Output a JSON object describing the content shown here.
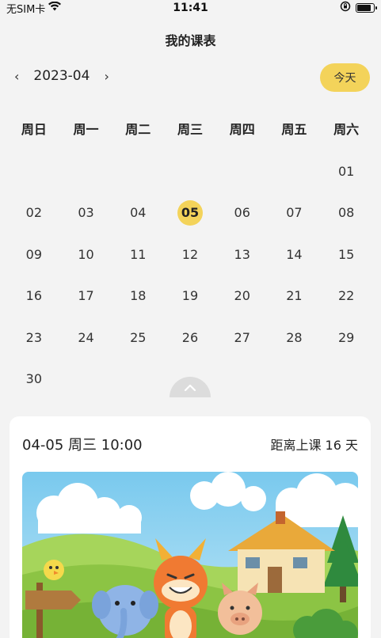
{
  "status": {
    "carrier": "无SIM卡",
    "time": "11:41",
    "battery_level": 0.75
  },
  "header": {
    "title": "我的课表"
  },
  "month_nav": {
    "prev_icon": "‹",
    "month": "2023-04",
    "next_icon": "›",
    "today_label": "今天"
  },
  "weekdays": [
    "周日",
    "周一",
    "周二",
    "周三",
    "周四",
    "周五",
    "周六"
  ],
  "calendar": {
    "leading_blanks": 6,
    "days": [
      "01",
      "02",
      "03",
      "04",
      "05",
      "06",
      "07",
      "08",
      "09",
      "10",
      "11",
      "12",
      "13",
      "14",
      "15",
      "16",
      "17",
      "18",
      "19",
      "20",
      "21",
      "22",
      "23",
      "24",
      "25",
      "26",
      "27",
      "28",
      "29",
      "30"
    ],
    "selected": "05"
  },
  "colors": {
    "accent": "#f3d35a",
    "background": "#f3f3f3"
  },
  "course_card": {
    "datetime": "04-05 周三 10:00",
    "countdown": "距离上课 16 天"
  }
}
